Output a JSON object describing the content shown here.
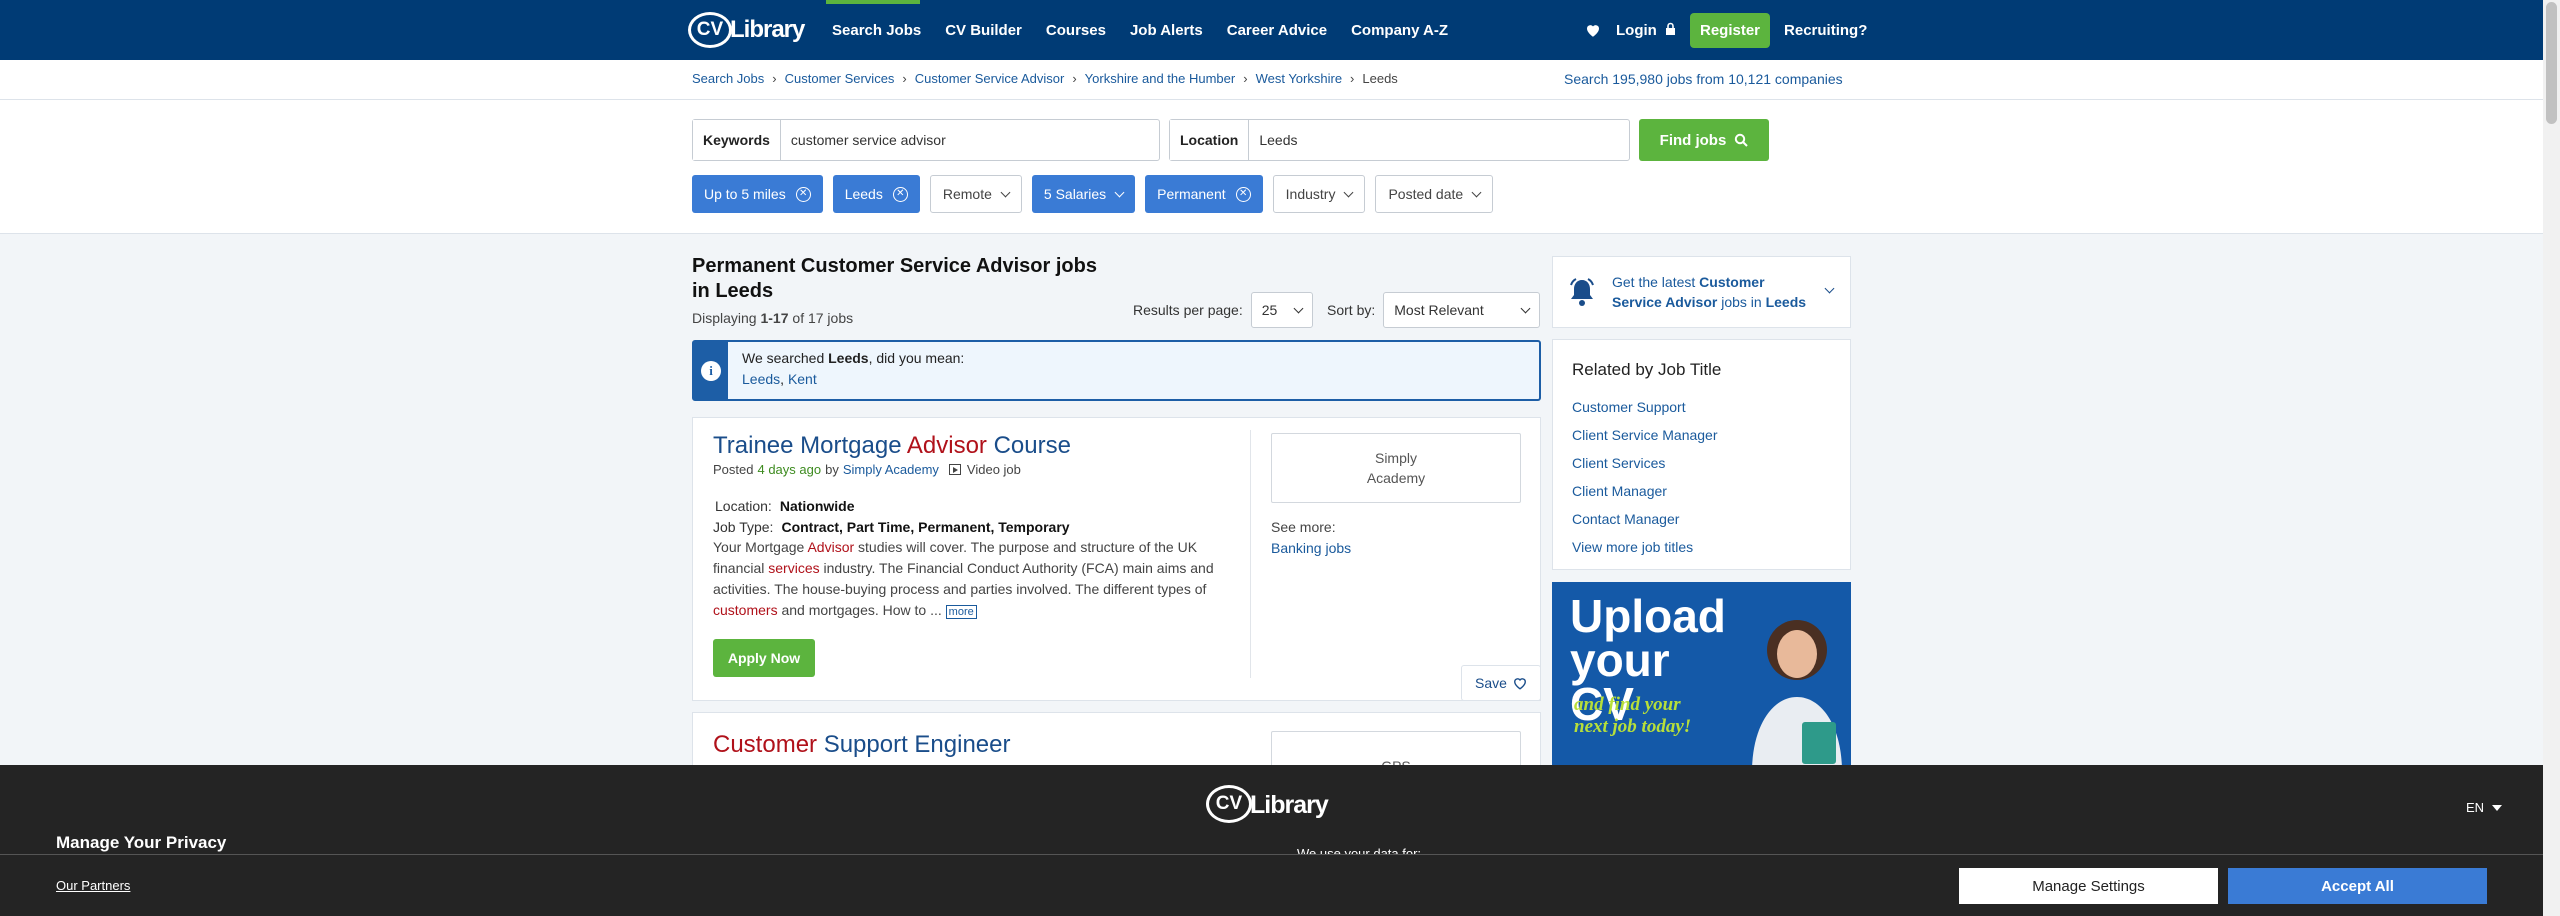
{
  "nav": {
    "logo_cv": "CV",
    "logo_library": "Library",
    "links": [
      "Search Jobs",
      "CV Builder",
      "Courses",
      "Job Alerts",
      "Career Advice",
      "Company A-Z"
    ],
    "login": "Login",
    "register": "Register",
    "recruiting": "Recruiting?"
  },
  "breadcrumb": {
    "items": [
      "Search Jobs",
      "Customer Services",
      "Customer Service Advisor",
      "Yorkshire and the Humber",
      "West Yorkshire"
    ],
    "current": "Leeds",
    "search_prefix": "Search ",
    "job_count": "195,980",
    "jobs_word": " jobs",
    "from": " from ",
    "company_count": "10,121",
    "companies_word": " companies"
  },
  "search": {
    "keywords_label": "Keywords",
    "keywords_value": "customer service advisor",
    "location_label": "Location",
    "location_value": "Leeds",
    "find_button": "Find jobs"
  },
  "filters": [
    {
      "label": "Up to 5 miles",
      "active": true
    },
    {
      "label": "Leeds",
      "active": true
    },
    {
      "label": "Remote",
      "active": false
    },
    {
      "label": "5 Salaries",
      "active": true
    },
    {
      "label": "Permanent",
      "active": true
    },
    {
      "label": "Industry",
      "active": false
    },
    {
      "label": "Posted date",
      "active": false
    }
  ],
  "results": {
    "heading": "Permanent Customer Service Advisor jobs in Leeds",
    "displaying_prefix": "Displaying ",
    "range": "1-17",
    "of_total": " of 17 jobs",
    "per_page_label": "Results per page:",
    "per_page_value": "25",
    "sort_label": "Sort by:",
    "sort_value": "Most Relevant"
  },
  "did_you_mean": {
    "text_pre": "We searched ",
    "term": "Leeds",
    "text_post": ", did you mean:",
    "suggestion_1": "Leeds",
    "sep": ", ",
    "suggestion_2": "Kent"
  },
  "jobs": [
    {
      "title_parts": [
        "Trainee Mortgage ",
        "Advisor",
        " Course"
      ],
      "posted_label": "Posted",
      "posted_ago": "4 days ago",
      "by": "by",
      "company": "Simply Academy",
      "video": "Video job",
      "location_label": "Location:",
      "location": "Nationwide",
      "type_label": "Job Type:",
      "job_type": "Contract, Part Time, Permanent, Temporary",
      "desc_1": "Your Mortgage ",
      "desc_hl_1": "Advisor",
      "desc_2": " studies will cover. The purpose and structure of the UK financial ",
      "desc_hl_2": "services",
      "desc_3": " industry. The Financial Conduct Authority (FCA) main aims and activities. The house-buying process and parties involved. The different types of ",
      "desc_hl_3": "customers",
      "desc_4": " and mortgages. How to ... ",
      "more": "more",
      "apply": "Apply Now",
      "logo_alt": "Simply Academy",
      "see_more": "See more:",
      "see_more_link": "Banking jobs",
      "save": "Save"
    },
    {
      "title_parts": [
        "Customer",
        " Support Engineer"
      ],
      "logo_alt": "GPS"
    }
  ],
  "sidebar": {
    "alert_pre": "Get the latest ",
    "alert_term": "Customer Service Advisor",
    "alert_mid": " jobs in ",
    "alert_loc": "Leeds",
    "related_heading": "Related by Job Title",
    "related": [
      "Customer Support",
      "Client Service Manager",
      "Client Services",
      "Client Manager",
      "Contact Manager",
      "View more job titles"
    ],
    "ad_line1": "Upload your CV",
    "ad_line2": "and find your next job today!"
  },
  "privacy": {
    "logo_cv": "CV",
    "logo_library": "Library",
    "lang": "EN",
    "title": "Manage Your Privacy",
    "we_use": "We use your data for:",
    "partners": "Our Partners",
    "manage_settings": "Manage Settings",
    "accept_all": "Accept All"
  },
  "colors": {
    "nav": "#003b75",
    "green": "#5cb43e",
    "chip": "#3a7bd5",
    "highlight": "#b0111a",
    "link": "#1a5a9c"
  }
}
